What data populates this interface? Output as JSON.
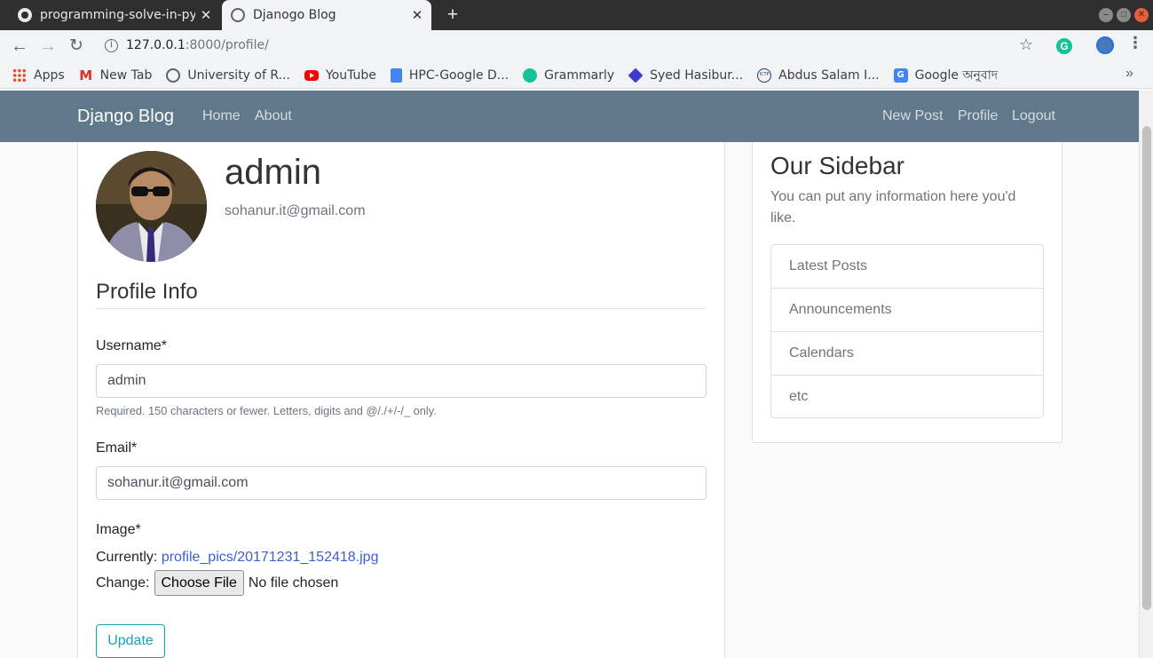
{
  "browser": {
    "tabs": [
      {
        "title": "programming-solve-in-py",
        "icon": "github-icon"
      },
      {
        "title": "Djanogo Blog",
        "icon": "globe-icon"
      }
    ],
    "url_host": "127.0.0.1",
    "url_path": ":8000/profile/",
    "bookmarks": [
      {
        "label": "Apps",
        "icon": "apps-grid-icon"
      },
      {
        "label": "New Tab",
        "icon": "gmail-icon"
      },
      {
        "label": "University of R...",
        "icon": "globe-icon"
      },
      {
        "label": "YouTube",
        "icon": "youtube-icon"
      },
      {
        "label": "HPC-Google D...",
        "icon": "google-docs-icon"
      },
      {
        "label": "Grammarly",
        "icon": "grammarly-icon"
      },
      {
        "label": "Syed Hasibur...",
        "icon": "dropbox-icon"
      },
      {
        "label": "Abdus Salam I...",
        "icon": "ictp-icon"
      },
      {
        "label": "Google অনুবাদ",
        "icon": "google-translate-icon"
      }
    ]
  },
  "navbar": {
    "brand": "Django Blog",
    "left_links": [
      "Home",
      "About"
    ],
    "right_links": [
      "New Post",
      "Profile",
      "Logout"
    ],
    "background": "#5f788a"
  },
  "profile": {
    "username": "admin",
    "email": "sohanur.it@gmail.com",
    "section_title": "Profile Info"
  },
  "form": {
    "username_label": "Username*",
    "username_value": "admin",
    "username_help": "Required. 150 characters or fewer. Letters, digits and @/./+/-/_ only.",
    "email_label": "Email*",
    "email_value": "sohanur.it@gmail.com",
    "image_label": "Image*",
    "currently_label": "Currently:",
    "current_file": "profile_pics/20171231_152418.jpg",
    "change_label": "Change:",
    "choose_file_button": "Choose File",
    "no_file_text": "No file chosen",
    "submit_label": "Update",
    "accent_color": "#17a2b8"
  },
  "sidebar": {
    "title": "Our Sidebar",
    "text": "You can put any information here you'd like.",
    "items": [
      "Latest Posts",
      "Announcements",
      "Calendars",
      "etc"
    ]
  }
}
